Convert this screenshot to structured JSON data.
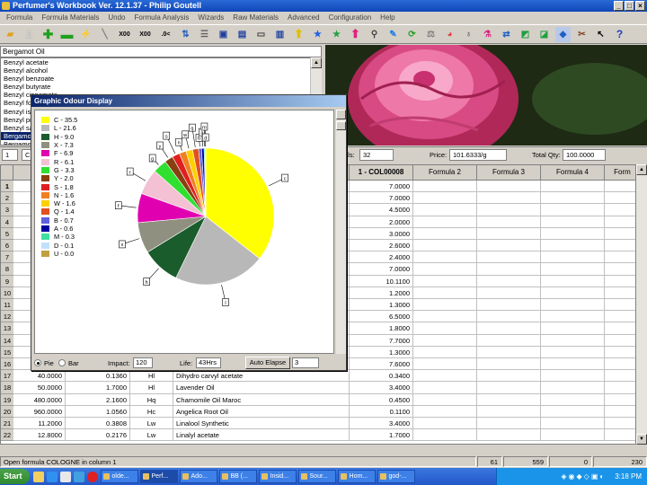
{
  "window": {
    "title": "Perfumer's Workbook Ver. 12.1.37 - Philip Goutell"
  },
  "menu": [
    "Formula",
    "Formula Materials",
    "Undo",
    "Formula Analysis",
    "Wizards",
    "Raw Materials",
    "Advanced",
    "Configuration",
    "Help"
  ],
  "toolbar": {
    "labels": [
      "X00",
      "X00",
      ".0<"
    ]
  },
  "materials": {
    "input_value": "Bergamot Oil",
    "items": [
      "Benzyl acetate",
      "Benzyl alcohol",
      "Benzyl benzoate",
      "Benzyl butyrate",
      "Benzyl cinnamate",
      "Benzyl formate",
      "Benzyl isobutyrate",
      "Benzyl propionate",
      "Benzyl salicylate",
      "Bergamot Oil",
      "Bergamot"
    ],
    "selected_index": 9
  },
  "info": {
    "materials_label": "als:",
    "materials_value": "32",
    "price_label": "Price:",
    "price_value": "101.6333/g",
    "total_label": "Total Qty:",
    "total_value": "100.0000",
    "formula_col1": "1",
    "formula_col2": "C"
  },
  "grid": {
    "headers": [
      "1 - COL00008",
      "Formula 2",
      "Formula 3",
      "Formula 4",
      "Form"
    ],
    "left_header": "Pr",
    "rows": [
      {
        "n": "1",
        "a": "",
        "b": "",
        "c": "",
        "d": "",
        "v": "7.0000"
      },
      {
        "n": "2",
        "a": "",
        "b": "",
        "c": "",
        "d": "",
        "v": "7.0000"
      },
      {
        "n": "3",
        "a": "",
        "b": "",
        "c": "",
        "d": "",
        "v": "4.5000"
      },
      {
        "n": "4",
        "a": "",
        "b": "",
        "c": "",
        "d": "",
        "v": "2.0000"
      },
      {
        "n": "5",
        "a": "",
        "b": "",
        "c": "",
        "d": "",
        "v": "3.0000"
      },
      {
        "n": "6",
        "a": "",
        "b": "",
        "c": "",
        "d": "",
        "v": "2.6000"
      },
      {
        "n": "7",
        "a": "",
        "b": "",
        "c": "",
        "d": "",
        "v": "2.4000"
      },
      {
        "n": "8",
        "a": "",
        "b": "",
        "c": "",
        "d": "",
        "v": "7.0000"
      },
      {
        "n": "9",
        "a": "",
        "b": "",
        "c": "",
        "d": "",
        "v": "10.1100"
      },
      {
        "n": "10",
        "a": "",
        "b": "",
        "c": "",
        "d": "",
        "v": "1.2000"
      },
      {
        "n": "11",
        "a": "",
        "b": "",
        "c": "",
        "d": "",
        "v": "1.3000"
      },
      {
        "n": "12",
        "a": "",
        "b": "",
        "c": "",
        "d": "",
        "v": "6.5000"
      },
      {
        "n": "13",
        "a": "",
        "b": "",
        "c": "",
        "d": "",
        "v": "1.8000"
      },
      {
        "n": "14",
        "a": "",
        "b": "",
        "c": "",
        "d": "",
        "v": "7.7000"
      },
      {
        "n": "15",
        "a": "",
        "b": "",
        "c": "",
        "d": "",
        "v": "1.3000"
      },
      {
        "n": "16",
        "a": "",
        "b": "",
        "c": "",
        "d": "",
        "v": "7.6000"
      },
      {
        "n": "17",
        "a": "40.0000",
        "b": "0.1360",
        "c": "Hl",
        "d": "Dihydro carvyl acetate",
        "v": "0.3400"
      },
      {
        "n": "18",
        "a": "50.0000",
        "b": "1.7000",
        "c": "Hl",
        "d": "Lavender Oil",
        "v": "3.4000"
      },
      {
        "n": "19",
        "a": "480.0000",
        "b": "2.1600",
        "c": "Hq",
        "d": "Chamomile Oil Maroc",
        "v": "0.4500"
      },
      {
        "n": "20",
        "a": "960.0000",
        "b": "1.0560",
        "c": "Hc",
        "d": "Angelica Root Oil",
        "v": "0.1100"
      },
      {
        "n": "21",
        "a": "11.2000",
        "b": "0.3808",
        "c": "Lw",
        "d": "Linalool Synthetic",
        "v": "3.4000"
      },
      {
        "n": "22",
        "a": "12.8000",
        "b": "0.2176",
        "c": "Lw",
        "d": "Linalyl acetate",
        "v": "1.7000"
      }
    ]
  },
  "status": {
    "text": "Open formula COLOGNE in column 1",
    "v1": "61",
    "v2": "559",
    "v3": "0",
    "v4": "230"
  },
  "taskbar": {
    "start": "Start",
    "tasks": [
      "olde...",
      "Perf...",
      "Ado...",
      "BB (...",
      "Insid...",
      "Sour...",
      "Hom...",
      "god-..."
    ],
    "active_index": 1,
    "clock": "3:18 PM"
  },
  "odour": {
    "title": "Graphic Odour Display",
    "pie_label": "Pie",
    "bar_label": "Bar",
    "impact_label": "Impact:",
    "impact_value": "120",
    "life_label": "Life:",
    "life_value": "43Hrs",
    "auto_btn": "Auto Elapse",
    "auto_value": "3",
    "view": "pie"
  },
  "chart_data": {
    "type": "pie",
    "series": [
      {
        "code": "C",
        "value": 35.5,
        "color": "#ffff00"
      },
      {
        "code": "L",
        "value": 21.6,
        "color": "#b8b8b8"
      },
      {
        "code": "H",
        "value": 9.0,
        "color": "#1a5c2c"
      },
      {
        "code": "X",
        "value": 7.3,
        "color": "#909080"
      },
      {
        "code": "F",
        "value": 6.9,
        "color": "#e000b0"
      },
      {
        "code": "R",
        "value": 6.1,
        "color": "#f4c0d4"
      },
      {
        "code": "G",
        "value": 3.3,
        "color": "#30e030"
      },
      {
        "code": "Y",
        "value": 2.0,
        "color": "#884010"
      },
      {
        "code": "S",
        "value": 1.8,
        "color": "#e02020"
      },
      {
        "code": "N",
        "value": 1.6,
        "color": "#f08020"
      },
      {
        "code": "W",
        "value": 1.6,
        "color": "#ffd000"
      },
      {
        "code": "Q",
        "value": 1.4,
        "color": "#e05020"
      },
      {
        "code": "B",
        "value": 0.7,
        "color": "#6060e0"
      },
      {
        "code": "A",
        "value": 0.6,
        "color": "#0000a0"
      },
      {
        "code": "M",
        "value": 0.3,
        "color": "#40e0a0"
      },
      {
        "code": "D",
        "value": 0.1,
        "color": "#c0e0ff"
      },
      {
        "code": "U",
        "value": 0.0,
        "color": "#c0a040"
      }
    ],
    "legend_position": "left"
  }
}
